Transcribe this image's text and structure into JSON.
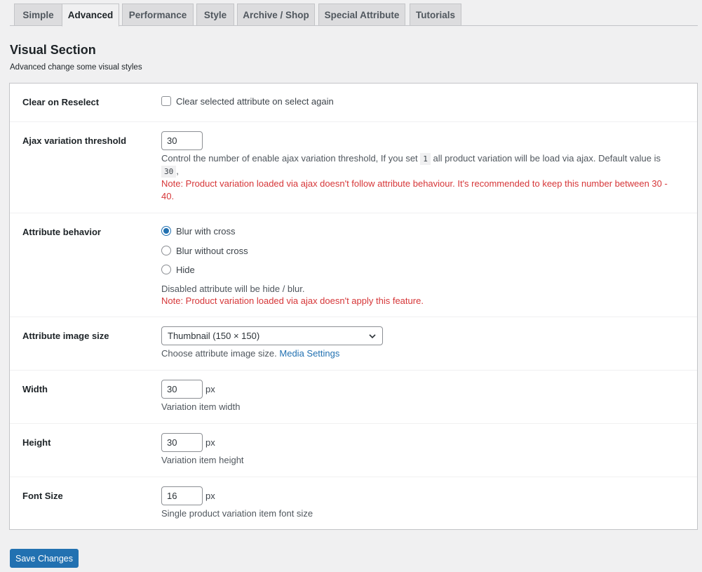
{
  "tabs": [
    "Simple",
    "Advanced",
    "Performance",
    "Style",
    "Archive / Shop",
    "Special Attribute",
    "Tutorials"
  ],
  "active_tab": "Advanced",
  "section": {
    "title": "Visual Section",
    "description": "Advanced change some visual styles"
  },
  "clear_on_reselect": {
    "label": "Clear on Reselect",
    "checkbox_label": "Clear selected attribute on select again",
    "checked": false
  },
  "ajax_threshold": {
    "label": "Ajax variation threshold",
    "value": "30",
    "help_before": "Control the number of enable ajax variation threshold, If you set",
    "code_one": "1",
    "help_after": "all product variation will be load via ajax. Default value is",
    "code_default": "30",
    "help_end": ",",
    "note_line1": "Note: Product variation loaded via ajax doesn't follow attribute behaviour. It's recommended to keep this number between 30 -",
    "note_line2": "40."
  },
  "attribute_behavior": {
    "label": "Attribute behavior",
    "options": [
      "Blur with cross",
      "Blur without cross",
      "Hide"
    ],
    "selected": "Blur with cross",
    "help": "Disabled attribute will be hide / blur.",
    "note": "Note: Product variation loaded via ajax doesn't apply this feature."
  },
  "image_size": {
    "label": "Attribute image size",
    "selected": "Thumbnail (150 × 150)",
    "help": "Choose attribute image size.",
    "link": "Media Settings"
  },
  "width": {
    "label": "Width",
    "value": "30",
    "unit": "px",
    "help": "Variation item width"
  },
  "height": {
    "label": "Height",
    "value": "30",
    "unit": "px",
    "help": "Variation item height"
  },
  "font_size": {
    "label": "Font Size",
    "value": "16",
    "unit": "px",
    "help": "Single product variation item font size"
  },
  "save_label": "Save Changes",
  "colors": {
    "accent": "#2271b1",
    "note_red": "#d63638",
    "background": "#f0f0f1"
  }
}
